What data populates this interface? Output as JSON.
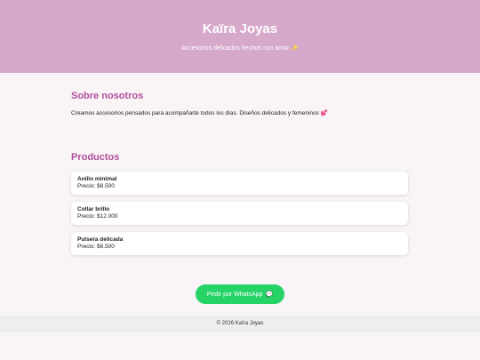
{
  "header": {
    "brand": "Kaïra Joyas",
    "tagline": "Accesorios delicados hechos con amor ✨"
  },
  "about": {
    "title": "Sobre nosotros",
    "text": "Creamos accesorios pensados para acompañarte todos los días. Diseños delicados y femeninos 💕"
  },
  "products": {
    "title": "Productos",
    "items": [
      {
        "name": "Anillo minimal",
        "price": "Precio: $8.500"
      },
      {
        "name": "Collar brillo",
        "price": "Precio: $12.000"
      },
      {
        "name": "Pulsera delicada",
        "price": "Precio: $6.500"
      }
    ]
  },
  "cta": {
    "label": "Pedir por WhatsApp",
    "icon": "speech-bubble-icon",
    "glyph": "💬"
  },
  "footer": {
    "text": "© 2026 Kaïra Joyas"
  },
  "colors": {
    "header_bg": "#d6a8ca",
    "accent": "#b04f9a",
    "whatsapp": "#25d366"
  }
}
